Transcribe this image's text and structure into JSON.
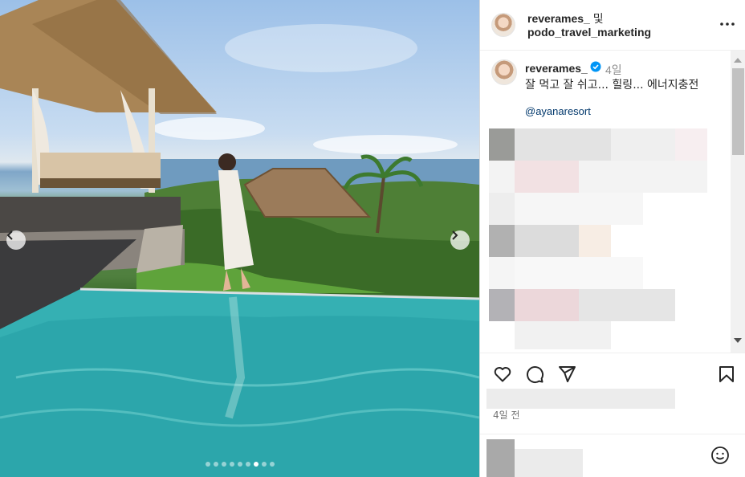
{
  "post": {
    "owner_primary": "reverames_",
    "owner_conjunction": "및",
    "owner_collab": "podo_travel_marketing",
    "caption": {
      "username": "reverames_",
      "verified": true,
      "time_ago": "4일",
      "text": "잘 먹고 잘 쉬고... 힐링... 에너지충전",
      "mention": "@ayanaresort"
    },
    "date": "4일 전"
  },
  "carousel": {
    "total_slides": 9,
    "active_index": 6
  },
  "icons": {
    "more": "more-horizontal-icon",
    "like": "heart-icon",
    "comment": "comment-icon",
    "share": "send-icon",
    "save": "bookmark-icon",
    "prev": "chevron-left-icon",
    "next": "chevron-right-icon",
    "emoji": "emoji-icon",
    "verified": "verified-badge-icon"
  },
  "colors": {
    "verified_badge": "#0095f6",
    "mention_link": "#00376b",
    "secondary_text": "#8e8e8e"
  }
}
